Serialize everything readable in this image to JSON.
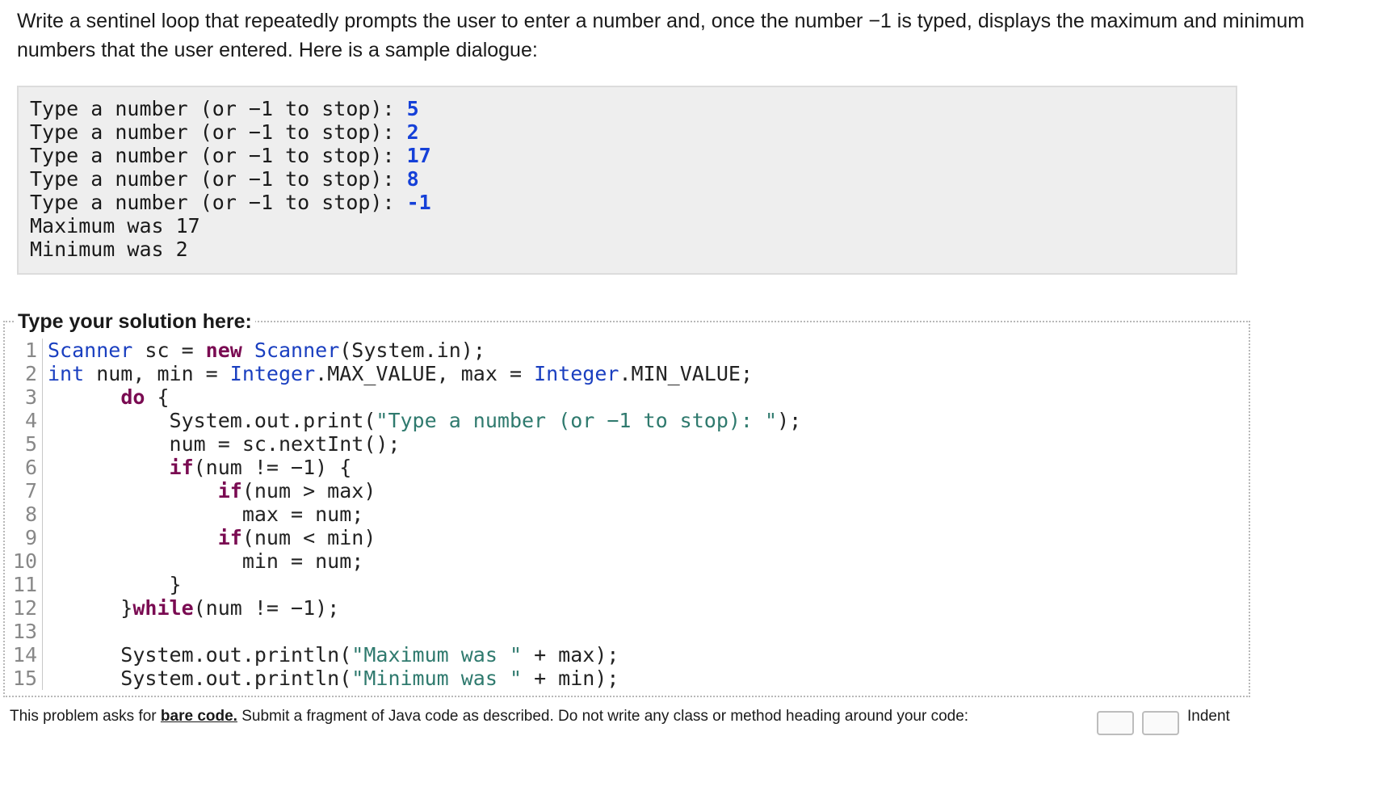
{
  "prompt": {
    "text": "Write a sentinel loop that repeatedly prompts the user to enter a number and, once the number −1 is typed, displays the maximum and minimum numbers that the user entered. Here is a sample dialogue:"
  },
  "sample_dialogue": {
    "prompt_text": "Type a number (or −1 to stop): ",
    "inputs": [
      "5",
      "2",
      "17",
      "8",
      "-1"
    ],
    "output_lines": [
      "Maximum was 17",
      "Minimum was 2"
    ]
  },
  "editor": {
    "legend": "Type your solution here:",
    "lines": [
      [
        {
          "t": "Scanner",
          "c": "ty"
        },
        {
          "t": " sc = ",
          "c": "src"
        },
        {
          "t": "new",
          "c": "kw"
        },
        {
          "t": " ",
          "c": "src"
        },
        {
          "t": "Scanner",
          "c": "ty"
        },
        {
          "t": "(System.in);",
          "c": "src"
        }
      ],
      [
        {
          "t": "int",
          "c": "ty"
        },
        {
          "t": " num, min = ",
          "c": "src"
        },
        {
          "t": "Integer",
          "c": "ty"
        },
        {
          "t": ".MAX_VALUE, max = ",
          "c": "src"
        },
        {
          "t": "Integer",
          "c": "ty"
        },
        {
          "t": ".MIN_VALUE;",
          "c": "src"
        }
      ],
      [
        {
          "t": "      ",
          "c": "src"
        },
        {
          "t": "do",
          "c": "kw"
        },
        {
          "t": " {",
          "c": "src"
        }
      ],
      [
        {
          "t": "          System.out.print(",
          "c": "src"
        },
        {
          "t": "\"Type a number (or −1 to stop): \"",
          "c": "str"
        },
        {
          "t": ");",
          "c": "src"
        }
      ],
      [
        {
          "t": "          num = sc.nextInt();",
          "c": "src"
        }
      ],
      [
        {
          "t": "          ",
          "c": "src"
        },
        {
          "t": "if",
          "c": "kw"
        },
        {
          "t": "(num != −1) {",
          "c": "src"
        }
      ],
      [
        {
          "t": "              ",
          "c": "src"
        },
        {
          "t": "if",
          "c": "kw"
        },
        {
          "t": "(num > max)",
          "c": "src"
        }
      ],
      [
        {
          "t": "                max = num;",
          "c": "src"
        }
      ],
      [
        {
          "t": "              ",
          "c": "src"
        },
        {
          "t": "if",
          "c": "kw"
        },
        {
          "t": "(num < min)",
          "c": "src"
        }
      ],
      [
        {
          "t": "                min = num;",
          "c": "src"
        }
      ],
      [
        {
          "t": "          }",
          "c": "src"
        }
      ],
      [
        {
          "t": "      }",
          "c": "src"
        },
        {
          "t": "while",
          "c": "kw"
        },
        {
          "t": "(num != −1);",
          "c": "src"
        }
      ],
      [
        {
          "t": "",
          "c": "src"
        }
      ],
      [
        {
          "t": "      System.out.println(",
          "c": "src"
        },
        {
          "t": "\"Maximum was \"",
          "c": "str"
        },
        {
          "t": " + max);",
          "c": "src"
        }
      ],
      [
        {
          "t": "      System.out.println(",
          "c": "src"
        },
        {
          "t": "\"Minimum was \"",
          "c": "str"
        },
        {
          "t": " + min);",
          "c": "src"
        }
      ]
    ]
  },
  "footer": {
    "text_before": "This problem asks for ",
    "bold": "bare code.",
    "text_after": " Submit a fragment of Java code as described. Do not write any class or method heading around your code:",
    "right_label": "Indent"
  }
}
